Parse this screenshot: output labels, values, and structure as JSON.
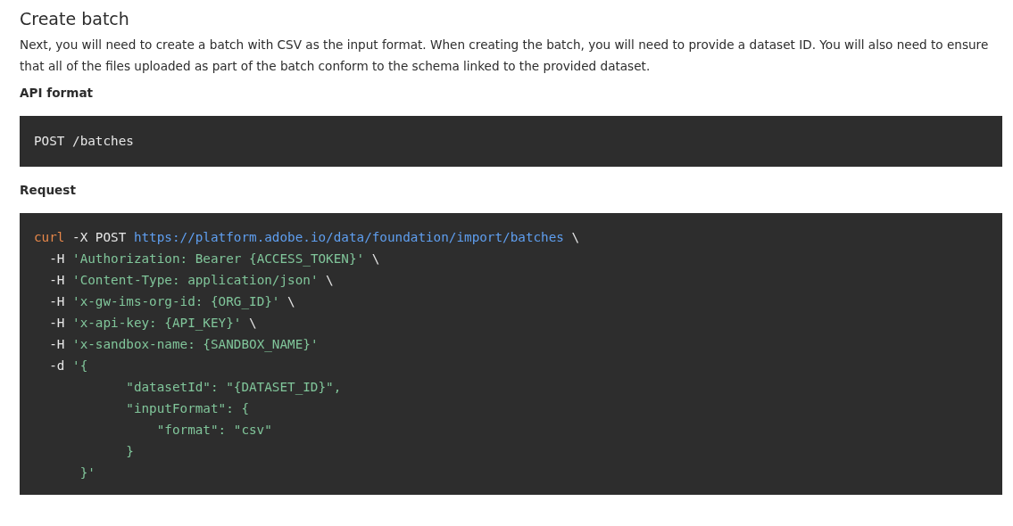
{
  "heading": "Create batch",
  "intro": "Next, you will need to create a batch with CSV as the input format. When creating the batch, you will need to provide a dataset ID. You will also need to ensure that all of the files uploaded as part of the batch conform to the schema linked to the provided dataset.",
  "sections": [
    {
      "label": "API format",
      "code": [
        [
          {
            "kind": "plain",
            "text": "POST /batches"
          }
        ]
      ]
    },
    {
      "label": "Request",
      "code": [
        [
          {
            "kind": "keyword",
            "text": "curl"
          },
          {
            "kind": "plain",
            "text": " -X POST "
          },
          {
            "kind": "url",
            "text": "https://platform.adobe.io/data/foundation/import/batches"
          },
          {
            "kind": "plain",
            "text": " \\"
          }
        ],
        [
          {
            "kind": "plain",
            "text": "  -H "
          },
          {
            "kind": "string",
            "text": "'Authorization: Bearer {ACCESS_TOKEN}'"
          },
          {
            "kind": "plain",
            "text": " \\"
          }
        ],
        [
          {
            "kind": "plain",
            "text": "  -H "
          },
          {
            "kind": "string",
            "text": "'Content-Type: application/json'"
          },
          {
            "kind": "plain",
            "text": " \\"
          }
        ],
        [
          {
            "kind": "plain",
            "text": "  -H "
          },
          {
            "kind": "string",
            "text": "'x-gw-ims-org-id: {ORG_ID}'"
          },
          {
            "kind": "plain",
            "text": " \\"
          }
        ],
        [
          {
            "kind": "plain",
            "text": "  -H "
          },
          {
            "kind": "string",
            "text": "'x-api-key: {API_KEY}'"
          },
          {
            "kind": "plain",
            "text": " \\"
          }
        ],
        [
          {
            "kind": "plain",
            "text": "  -H "
          },
          {
            "kind": "string",
            "text": "'x-sandbox-name: {SANDBOX_NAME}'"
          }
        ],
        [
          {
            "kind": "plain",
            "text": "  -d "
          },
          {
            "kind": "string",
            "text": "'{"
          }
        ],
        [
          {
            "kind": "string",
            "text": "            \"datasetId\": \"{DATASET_ID}\","
          }
        ],
        [
          {
            "kind": "string",
            "text": "            \"inputFormat\": {"
          }
        ],
        [
          {
            "kind": "string",
            "text": "                \"format\": \"csv\""
          }
        ],
        [
          {
            "kind": "string",
            "text": "            }"
          }
        ],
        [
          {
            "kind": "string",
            "text": "      }'"
          }
        ]
      ]
    }
  ]
}
